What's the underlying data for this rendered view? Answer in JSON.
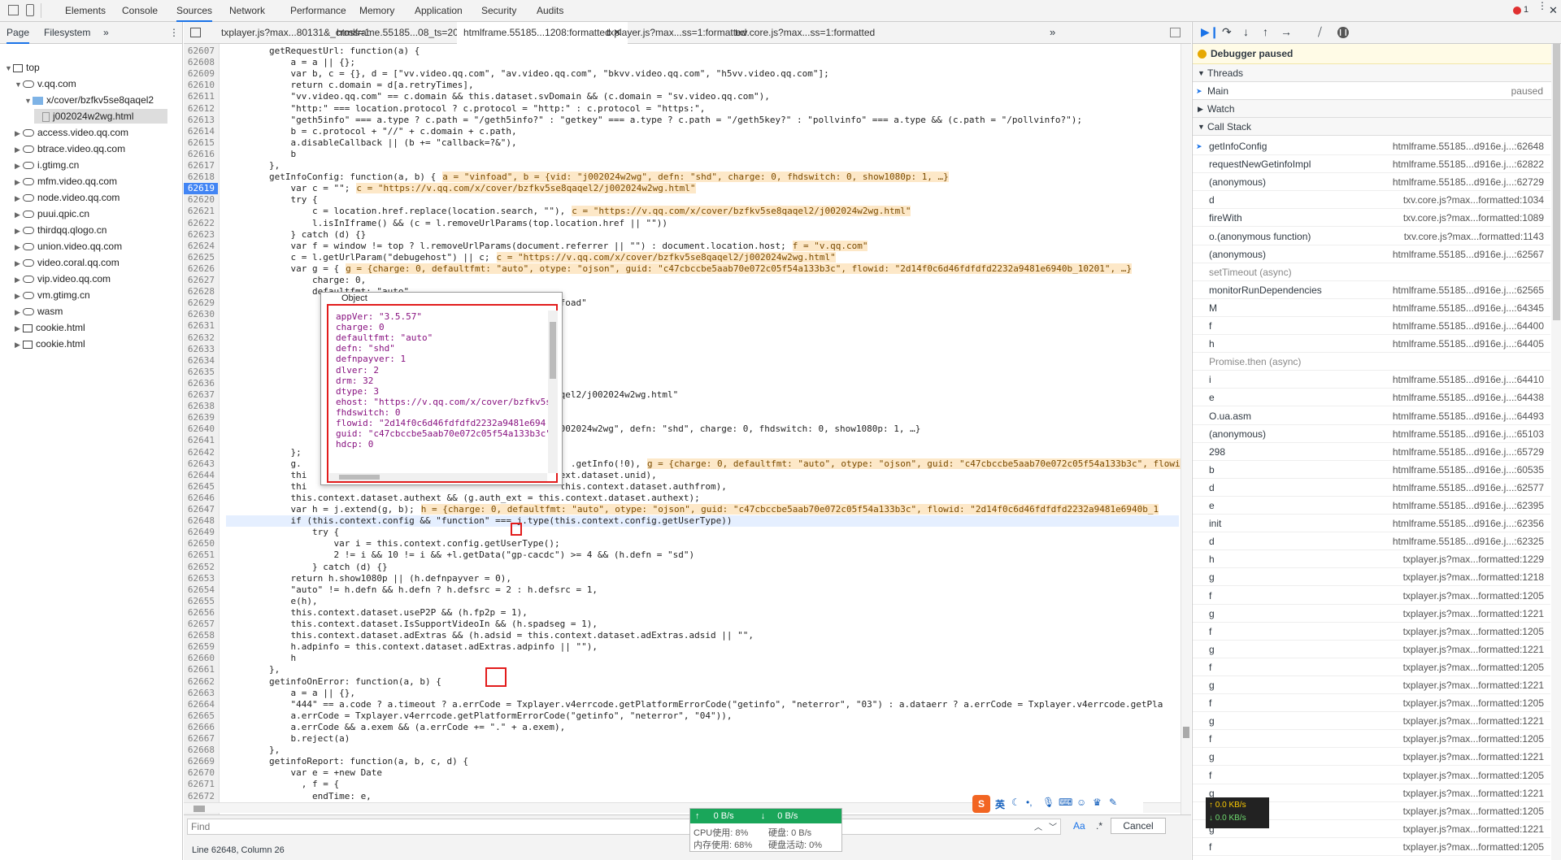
{
  "top_tabs": [
    "Elements",
    "Console",
    "Sources",
    "Network",
    "Performance",
    "Memory",
    "Application",
    "Security",
    "Audits"
  ],
  "active_top_tab": "Sources",
  "error_badge": "1",
  "nav_tabs": [
    "Page",
    "Filesystem"
  ],
  "tree": [
    {
      "label": "top",
      "depth": 0,
      "type": "frame",
      "expanded": true
    },
    {
      "label": "v.qq.com",
      "depth": 1,
      "type": "domain",
      "expanded": true
    },
    {
      "label": "x/cover/bzfkv5se8qaqel2",
      "depth": 2,
      "type": "folder",
      "expanded": true
    },
    {
      "label": "j002024w2wg.html",
      "depth": 3,
      "type": "file",
      "selected": true
    },
    {
      "label": "access.video.qq.com",
      "depth": 1,
      "type": "domain"
    },
    {
      "label": "btrace.video.qq.com",
      "depth": 1,
      "type": "domain"
    },
    {
      "label": "i.gtimg.cn",
      "depth": 1,
      "type": "domain"
    },
    {
      "label": "mfm.video.qq.com",
      "depth": 1,
      "type": "domain"
    },
    {
      "label": "node.video.qq.com",
      "depth": 1,
      "type": "domain"
    },
    {
      "label": "puui.qpic.cn",
      "depth": 1,
      "type": "domain"
    },
    {
      "label": "thirdqq.qlogo.cn",
      "depth": 1,
      "type": "domain"
    },
    {
      "label": "union.video.qq.com",
      "depth": 1,
      "type": "domain"
    },
    {
      "label": "video.coral.qq.com",
      "depth": 1,
      "type": "domain"
    },
    {
      "label": "vip.video.qq.com",
      "depth": 1,
      "type": "domain"
    },
    {
      "label": "vm.gtimg.cn",
      "depth": 1,
      "type": "domain"
    },
    {
      "label": "wasm",
      "depth": 1,
      "type": "domain"
    },
    {
      "label": "cookie.html",
      "depth": 1,
      "type": "frame"
    },
    {
      "label": "cookie.html",
      "depth": 1,
      "type": "frame"
    }
  ],
  "file_tabs": [
    "txplayer.js?max...80131&_cross=1",
    "htmlframe.55185...08_ts=20171208",
    "htmlframe.55185...1208:formatted",
    "txplayer.js?max...ss=1:formatted",
    "txv.core.js?max...ss=1:formatted"
  ],
  "active_file_tab": "htmlframe.55185...1208:formatted",
  "code_lines": [
    {
      "n": "62607",
      "t": "        getRequestUrl: function(a) {"
    },
    {
      "n": "62608",
      "t": "            a = a || {};"
    },
    {
      "n": "62609",
      "t": "            var b, c = {}, d = [\"vv.video.qq.com\", \"av.video.qq.com\", \"bkvv.video.qq.com\", \"h5vv.video.qq.com\"];"
    },
    {
      "n": "62610",
      "t": "            return c.domain = d[a.retryTimes],"
    },
    {
      "n": "62611",
      "t": "            \"vv.video.qq.com\" == c.domain && this.dataset.svDomain && (c.domain = \"sv.video.qq.com\"),"
    },
    {
      "n": "62612",
      "t": "            \"http:\" === location.protocol ? c.protocol = \"http:\" : c.protocol = \"https:\","
    },
    {
      "n": "62613",
      "t": "            \"geth5info\" === a.type ? c.path = \"/geth5info?\" : \"getkey\" === a.type ? c.path = \"/geth5key?\" : \"pollvinfo\" === a.type && (c.path = \"/pollvinfo?\");"
    },
    {
      "n": "62614",
      "t": "            b = c.protocol + \"//\" + c.domain + c.path,"
    },
    {
      "n": "62615",
      "t": "            a.disableCallback || (b += \"callback=?&\"),"
    },
    {
      "n": "62616",
      "t": "            b"
    },
    {
      "n": "62617",
      "t": "        },"
    },
    {
      "n": "62618",
      "t": "        getInfoConfig: function(a, b) {",
      "hint": "a = \"vinfoad\", b = {vid: \"j002024w2wg\", defn: \"shd\", charge: 0, fhdswitch: 0, show1080p: 1, …}"
    },
    {
      "n": "62619",
      "t": "            var c = \"\";",
      "hint": "c = \"https://v.qq.com/x/cover/bzfkv5se8qaqel2/j002024w2wg.html\"",
      "bp": true
    },
    {
      "n": "62620",
      "t": "            try {"
    },
    {
      "n": "62621",
      "t": "                c = location.href.replace(location.search, \"\"),",
      "hint": "c = \"https://v.qq.com/x/cover/bzfkv5se8qaqel2/j002024w2wg.html\""
    },
    {
      "n": "62622",
      "t": "                l.isInIframe() && (c = l.removeUrlParams(top.location.href || \"\"))"
    },
    {
      "n": "62623",
      "t": "            } catch (d) {}"
    },
    {
      "n": "62624",
      "t": "            var f = window != top ? l.removeUrlParams(document.referrer || \"\") : document.location.host;",
      "hint": "f = \"v.qq.com\""
    },
    {
      "n": "62625",
      "t": "            c = l.getUrlParam(\"debugehost\") || c;",
      "hint": "c = \"https://v.qq.com/x/cover/bzfkv5se8qaqel2/j002024w2wg.html\""
    },
    {
      "n": "62626",
      "t": "            var g = {",
      "hint": "g = {charge: 0, defaultfmt: \"auto\", otype: \"ojson\", guid: \"c47cbccbe5aab70e072c05f54a133b3c\", flowid: \"2d14f0c6d46fdfdfd2232a9481e6940b_10201\", …}"
    },
    {
      "n": "62627",
      "t": "                charge: 0,"
    },
    {
      "n": "62628",
      "t": "                defaultfmt: \"auto\","
    },
    {
      "n": "62629",
      "t": "                                                      a = \"vinfoad\""
    },
    {
      "n": "62630",
      "t": ""
    },
    {
      "n": "62631",
      "t": ""
    },
    {
      "n": "62632",
      "t": ""
    },
    {
      "n": "62633",
      "t": ""
    },
    {
      "n": "62634",
      "t": ""
    },
    {
      "n": "62635",
      "t": ""
    },
    {
      "n": "62636",
      "t": ""
    },
    {
      "n": "62637",
      "t": "                                                      kv5se8qaqel2/j002024w2wg.html\""
    },
    {
      "n": "62638",
      "t": ""
    },
    {
      "n": "62639",
      "t": "                                                      : 0,"
    },
    {
      "n": "62640",
      "t": "                                                      {vid: \"j002024w2wg\", defn: \"shd\", charge: 0, fhdswitch: 0, show1080p: 1, …}"
    },
    {
      "n": "62641",
      "t": ""
    },
    {
      "n": "62642",
      "t": "            };"
    },
    {
      "n": "62643",
      "t": "            g.                                                  .getInfo(!0),",
      "hint": "g = {charge: 0, defaultfmt: \"auto\", otype: \"ojson\", guid: \"c47cbccbe5aab70e072c05f54a133b3c\", flowi"
    },
    {
      "n": "62644",
      "t": "            thi                                               ext.dataset.unid),"
    },
    {
      "n": "62645",
      "t": "            thi                                               this.context.dataset.authfrom),"
    },
    {
      "n": "62646",
      "t": "            this.context.dataset.authext && (g.auth_ext = this.context.dataset.authext);"
    },
    {
      "n": "62647",
      "t": "            var h = j.extend(g, b);",
      "hint": "h = {charge: 0, defaultfmt: \"auto\", otype: \"ojson\", guid: \"c47cbccbe5aab70e072c05f54a133b3c\", flowid: \"2d14f0c6d46fdfdfd2232a9481e6940b_1"
    },
    {
      "n": "62648",
      "t": "            if (this.context.config && \"function\" === j.type(this.context.config.getUserType))",
      "cur": true
    },
    {
      "n": "62649",
      "t": "                try {"
    },
    {
      "n": "62650",
      "t": "                    var i = this.context.config.getUserType();"
    },
    {
      "n": "62651",
      "t": "                    2 != i && 10 != i && +l.getData(\"gp-cacdc\") >= 4 && (h.defn = \"sd\")"
    },
    {
      "n": "62652",
      "t": "                } catch (d) {}"
    },
    {
      "n": "62653",
      "t": "            return h.show1080p || (h.defnpayver = 0),"
    },
    {
      "n": "62654",
      "t": "            \"auto\" != h.defn && h.defn ? h.defsrc = 2 : h.defsrc = 1,"
    },
    {
      "n": "62655",
      "t": "            e(h),"
    },
    {
      "n": "62656",
      "t": "            this.context.dataset.useP2P && (h.fp2p = 1),"
    },
    {
      "n": "62657",
      "t": "            this.context.dataset.IsSupportVideoIn && (h.spadseg = 1),"
    },
    {
      "n": "62658",
      "t": "            this.context.dataset.adExtras && (h.adsid = this.context.dataset.adExtras.adsid || \"\","
    },
    {
      "n": "62659",
      "t": "            h.adpinfo = this.context.dataset.adExtras.adpinfo || \"\"),"
    },
    {
      "n": "62660",
      "t": "            h"
    },
    {
      "n": "62661",
      "t": "        },"
    },
    {
      "n": "62662",
      "t": "        getinfoOnError: function(a, b) {"
    },
    {
      "n": "62663",
      "t": "            a = a || {},"
    },
    {
      "n": "62664",
      "t": "            \"444\" == a.code ? a.timeout ? a.errCode = Txplayer.v4errcode.getPlatformErrorCode(\"getinfo\", \"neterror\", \"03\") : a.dataerr ? a.errCode = Txplayer.v4errcode.getPla"
    },
    {
      "n": "62665",
      "t": "            a.errCode = Txplayer.v4errcode.getPlatformErrorCode(\"getinfo\", \"neterror\", \"04\")),"
    },
    {
      "n": "62666",
      "t": "            a.errCode && a.exem && (a.errCode += \".\" + a.exem),"
    },
    {
      "n": "62667",
      "t": "            b.reject(a)"
    },
    {
      "n": "62668",
      "t": "        },"
    },
    {
      "n": "62669",
      "t": "        getinfoReport: function(a, b, c, d) {"
    },
    {
      "n": "62670",
      "t": "            var e = +new Date"
    },
    {
      "n": "62671",
      "t": "              , f = {"
    },
    {
      "n": "62672",
      "t": "                endTime: e,"
    },
    {
      "n": "62673",
      "t": ""
    }
  ],
  "popover": {
    "title": "Object",
    "rows": [
      "appVer: \"3.5.57\"",
      "charge: 0",
      "defaultfmt: \"auto\"",
      "defn: \"shd\"",
      "defnpayver: 1",
      "dlver: 2",
      "drm: 32",
      "dtype: 3",
      "ehost: \"https://v.qq.com/x/cover/bzfkv5s",
      "fhdswitch: 0",
      "flowid: \"2d14f0c6d46fdfdfd2232a9481e694",
      "guid: \"c47cbccbe5aab70e072c05f54a133b3c\"",
      "hdcp: 0"
    ]
  },
  "debugger": {
    "paused_label": "Debugger paused",
    "threads_label": "Threads",
    "main_thread": "Main",
    "main_status": "paused",
    "watch_label": "Watch",
    "callstack_label": "Call Stack",
    "frames": [
      {
        "fn": "getInfoConfig",
        "loc": "htmlframe.55185...d916e.j...:62648",
        "current": true
      },
      {
        "fn": "requestNewGetinfoImpl",
        "loc": "htmlframe.55185...d916e.j...:62822"
      },
      {
        "fn": "(anonymous)",
        "loc": "htmlframe.55185...d916e.j...:62729"
      },
      {
        "fn": "d",
        "loc": "txv.core.js?max...formatted:1034"
      },
      {
        "fn": "fireWith",
        "loc": "txv.core.js?max...formatted:1089"
      },
      {
        "fn": "o.(anonymous function)",
        "loc": "txv.core.js?max...formatted:1143"
      },
      {
        "fn": "(anonymous)",
        "loc": "htmlframe.55185...d916e.j...:62567"
      },
      {
        "fn": "setTimeout (async)",
        "loc": "",
        "async": true
      },
      {
        "fn": "monitorRunDependencies",
        "loc": "htmlframe.55185...d916e.j...:62565"
      },
      {
        "fn": "M",
        "loc": "htmlframe.55185...d916e.j...:64345"
      },
      {
        "fn": "f",
        "loc": "htmlframe.55185...d916e.j...:64400"
      },
      {
        "fn": "h",
        "loc": "htmlframe.55185...d916e.j...:64405"
      },
      {
        "fn": "Promise.then (async)",
        "loc": "",
        "async": true
      },
      {
        "fn": "i",
        "loc": "htmlframe.55185...d916e.j...:64410"
      },
      {
        "fn": "e",
        "loc": "htmlframe.55185...d916e.j...:64438"
      },
      {
        "fn": "O.ua.asm",
        "loc": "htmlframe.55185...d916e.j...:64493"
      },
      {
        "fn": "(anonymous)",
        "loc": "htmlframe.55185...d916e.j...:65103"
      },
      {
        "fn": "298",
        "loc": "htmlframe.55185...d916e.j...:65729"
      },
      {
        "fn": "b",
        "loc": "htmlframe.55185...d916e.j...:60535"
      },
      {
        "fn": "d",
        "loc": "htmlframe.55185...d916e.j...:62577"
      },
      {
        "fn": "e",
        "loc": "htmlframe.55185...d916e.j...:62395"
      },
      {
        "fn": "init",
        "loc": "htmlframe.55185...d916e.j...:62356"
      },
      {
        "fn": "d",
        "loc": "htmlframe.55185...d916e.j...:62325"
      },
      {
        "fn": "h",
        "loc": "txplayer.js?max...formatted:1229"
      },
      {
        "fn": "g",
        "loc": "txplayer.js?max...formatted:1218"
      },
      {
        "fn": "f",
        "loc": "txplayer.js?max...formatted:1205"
      },
      {
        "fn": "g",
        "loc": "txplayer.js?max...formatted:1221"
      },
      {
        "fn": "f",
        "loc": "txplayer.js?max...formatted:1205"
      },
      {
        "fn": "g",
        "loc": "txplayer.js?max...formatted:1221"
      },
      {
        "fn": "f",
        "loc": "txplayer.js?max...formatted:1205"
      },
      {
        "fn": "g",
        "loc": "txplayer.js?max...formatted:1221"
      },
      {
        "fn": "f",
        "loc": "txplayer.js?max...formatted:1205"
      },
      {
        "fn": "g",
        "loc": "txplayer.js?max...formatted:1221"
      },
      {
        "fn": "f",
        "loc": "txplayer.js?max...formatted:1205"
      },
      {
        "fn": "g",
        "loc": "txplayer.js?max...formatted:1221"
      },
      {
        "fn": "f",
        "loc": "txplayer.js?max...formatted:1205"
      },
      {
        "fn": "g",
        "loc": "txplayer.js?max...formatted:1221"
      },
      {
        "fn": "f",
        "loc": "txplayer.js?max...formatted:1205"
      },
      {
        "fn": "g",
        "loc": "txplayer.js?max...formatted:1221"
      },
      {
        "fn": "f",
        "loc": "txplayer.js?max...formatted:1205"
      }
    ]
  },
  "find": {
    "placeholder": "Find",
    "match_case": "Aa",
    "regex": ".*",
    "cancel": "Cancel"
  },
  "status_bar": "Line 62648, Column 26",
  "net_widget": {
    "up": "0 B/s",
    "down": "0 B/s",
    "cpu": "CPU使用: 8%",
    "disk": "硬盘: 0 B/s",
    "mem": "内存使用: 68%",
    "disk_act": "硬盘活动: 0%"
  },
  "speed_widget": {
    "up": "0.0 KB/s",
    "down": "0.0 KB/s"
  },
  "ime_label": "英"
}
